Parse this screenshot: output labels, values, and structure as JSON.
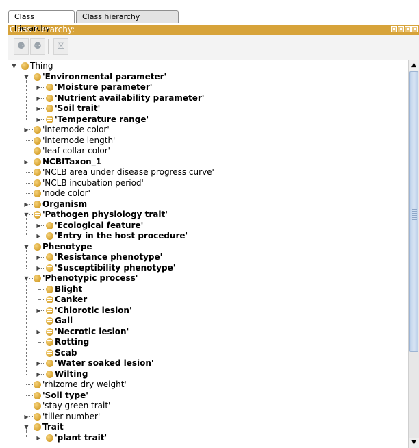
{
  "tabs": [
    {
      "label": "Class hierarchy",
      "active": true
    },
    {
      "label": "Class hierarchy (inferred)",
      "active": false
    }
  ],
  "panel": {
    "title": "Class hierarchy:",
    "accent_color": "#d7a33a",
    "toolbar_icons": [
      "add-subclass-icon",
      "add-sibling-class-icon",
      "delete-class-icon"
    ]
  },
  "tree": [
    {
      "label": "Thing",
      "bold": false,
      "depth": 0,
      "toggle": "expanded",
      "icon": "class"
    },
    {
      "label": "'Environmental parameter'",
      "bold": true,
      "depth": 1,
      "toggle": "expanded",
      "icon": "class"
    },
    {
      "label": "'Moisture parameter'",
      "bold": true,
      "depth": 2,
      "toggle": "collapsed",
      "icon": "class"
    },
    {
      "label": "'Nutrient availability parameter'",
      "bold": true,
      "depth": 2,
      "toggle": "collapsed",
      "icon": "class"
    },
    {
      "label": "'Soil trait'",
      "bold": true,
      "depth": 2,
      "toggle": "collapsed",
      "icon": "class"
    },
    {
      "label": "'Temperature range'",
      "bold": true,
      "depth": 2,
      "toggle": "collapsed",
      "icon": "defined"
    },
    {
      "label": "'internode color'",
      "bold": false,
      "depth": 1,
      "toggle": "collapsed",
      "icon": "class"
    },
    {
      "label": "'internode length'",
      "bold": false,
      "depth": 1,
      "toggle": "none",
      "icon": "class"
    },
    {
      "label": "'leaf collar color'",
      "bold": false,
      "depth": 1,
      "toggle": "none",
      "icon": "class"
    },
    {
      "label": "NCBITaxon_1",
      "bold": true,
      "depth": 1,
      "toggle": "collapsed",
      "icon": "class"
    },
    {
      "label": "'NCLB area under disease progress curve'",
      "bold": false,
      "depth": 1,
      "toggle": "none",
      "icon": "class"
    },
    {
      "label": "'NCLB incubation period'",
      "bold": false,
      "depth": 1,
      "toggle": "none",
      "icon": "class"
    },
    {
      "label": "'node color'",
      "bold": false,
      "depth": 1,
      "toggle": "none",
      "icon": "class"
    },
    {
      "label": "Organism",
      "bold": true,
      "depth": 1,
      "toggle": "collapsed",
      "icon": "class"
    },
    {
      "label": "'Pathogen physiology trait'",
      "bold": true,
      "depth": 1,
      "toggle": "expanded",
      "icon": "defined"
    },
    {
      "label": "'Ecological feature'",
      "bold": true,
      "depth": 2,
      "toggle": "collapsed",
      "icon": "class"
    },
    {
      "label": "'Entry in the host procedure'",
      "bold": true,
      "depth": 2,
      "toggle": "collapsed",
      "icon": "class"
    },
    {
      "label": "Phenotype",
      "bold": true,
      "depth": 1,
      "toggle": "expanded",
      "icon": "class"
    },
    {
      "label": "'Resistance phenotype'",
      "bold": true,
      "depth": 2,
      "toggle": "collapsed",
      "icon": "defined"
    },
    {
      "label": "'Susceptibility phenotype'",
      "bold": true,
      "depth": 2,
      "toggle": "collapsed",
      "icon": "defined"
    },
    {
      "label": "'Phenotypic process'",
      "bold": true,
      "depth": 1,
      "toggle": "expanded",
      "icon": "class"
    },
    {
      "label": "Blight",
      "bold": true,
      "depth": 2,
      "toggle": "none",
      "icon": "defined"
    },
    {
      "label": "Canker",
      "bold": true,
      "depth": 2,
      "toggle": "none",
      "icon": "defined"
    },
    {
      "label": "'Chlorotic lesion'",
      "bold": true,
      "depth": 2,
      "toggle": "collapsed",
      "icon": "defined"
    },
    {
      "label": "Gall",
      "bold": true,
      "depth": 2,
      "toggle": "none",
      "icon": "defined"
    },
    {
      "label": "'Necrotic lesion'",
      "bold": true,
      "depth": 2,
      "toggle": "collapsed",
      "icon": "defined"
    },
    {
      "label": "Rotting",
      "bold": true,
      "depth": 2,
      "toggle": "none",
      "icon": "defined"
    },
    {
      "label": "Scab",
      "bold": true,
      "depth": 2,
      "toggle": "none",
      "icon": "defined"
    },
    {
      "label": "'Water soaked lesion'",
      "bold": true,
      "depth": 2,
      "toggle": "collapsed",
      "icon": "defined"
    },
    {
      "label": "Wilting",
      "bold": true,
      "depth": 2,
      "toggle": "collapsed",
      "icon": "defined"
    },
    {
      "label": "'rhizome dry weight'",
      "bold": false,
      "depth": 1,
      "toggle": "none",
      "icon": "class"
    },
    {
      "label": "'Soil type'",
      "bold": true,
      "depth": 1,
      "toggle": "none",
      "icon": "class"
    },
    {
      "label": "'stay green trait'",
      "bold": false,
      "depth": 1,
      "toggle": "none",
      "icon": "class"
    },
    {
      "label": "'tiller number'",
      "bold": false,
      "depth": 1,
      "toggle": "collapsed",
      "icon": "class"
    },
    {
      "label": "Trait",
      "bold": true,
      "depth": 1,
      "toggle": "expanded",
      "icon": "class"
    },
    {
      "label": "'plant trait'",
      "bold": true,
      "depth": 2,
      "toggle": "collapsed",
      "icon": "class"
    }
  ]
}
